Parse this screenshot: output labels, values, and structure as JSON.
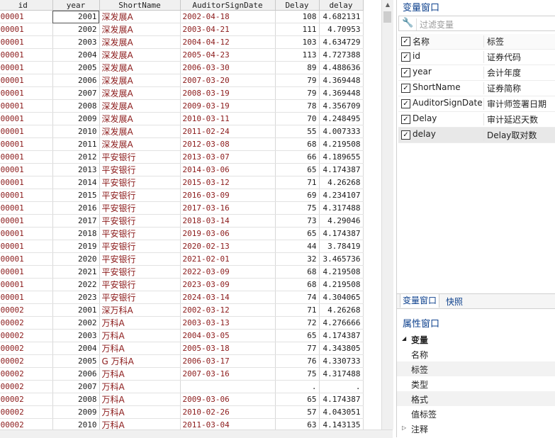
{
  "grid": {
    "columns": [
      "id",
      "year",
      "ShortName",
      "AuditorSignDate",
      "Delay",
      "delay"
    ],
    "rows": [
      [
        "000001",
        "2001",
        "深发展A",
        "2002-04-18",
        "108",
        "4.682131"
      ],
      [
        "000001",
        "2002",
        "深发展A",
        "2003-04-21",
        "111",
        "4.70953"
      ],
      [
        "000001",
        "2003",
        "深发展A",
        "2004-04-12",
        "103",
        "4.634729"
      ],
      [
        "000001",
        "2004",
        "深发展A",
        "2005-04-23",
        "113",
        "4.727388"
      ],
      [
        "000001",
        "2005",
        "深发展A",
        "2006-03-30",
        "89",
        "4.488636"
      ],
      [
        "000001",
        "2006",
        "深发展A",
        "2007-03-20",
        "79",
        "4.369448"
      ],
      [
        "000001",
        "2007",
        "深发展A",
        "2008-03-19",
        "79",
        "4.369448"
      ],
      [
        "000001",
        "2008",
        "深发展A",
        "2009-03-19",
        "78",
        "4.356709"
      ],
      [
        "000001",
        "2009",
        "深发展A",
        "2010-03-11",
        "70",
        "4.248495"
      ],
      [
        "000001",
        "2010",
        "深发展A",
        "2011-02-24",
        "55",
        "4.007333"
      ],
      [
        "000001",
        "2011",
        "深发展A",
        "2012-03-08",
        "68",
        "4.219508"
      ],
      [
        "000001",
        "2012",
        "平安银行",
        "2013-03-07",
        "66",
        "4.189655"
      ],
      [
        "000001",
        "2013",
        "平安银行",
        "2014-03-06",
        "65",
        "4.174387"
      ],
      [
        "000001",
        "2014",
        "平安银行",
        "2015-03-12",
        "71",
        "4.26268"
      ],
      [
        "000001",
        "2015",
        "平安银行",
        "2016-03-09",
        "69",
        "4.234107"
      ],
      [
        "000001",
        "2016",
        "平安银行",
        "2017-03-16",
        "75",
        "4.317488"
      ],
      [
        "000001",
        "2017",
        "平安银行",
        "2018-03-14",
        "73",
        "4.29046"
      ],
      [
        "000001",
        "2018",
        "平安银行",
        "2019-03-06",
        "65",
        "4.174387"
      ],
      [
        "000001",
        "2019",
        "平安银行",
        "2020-02-13",
        "44",
        "3.78419"
      ],
      [
        "000001",
        "2020",
        "平安银行",
        "2021-02-01",
        "32",
        "3.465736"
      ],
      [
        "000001",
        "2021",
        "平安银行",
        "2022-03-09",
        "68",
        "4.219508"
      ],
      [
        "000001",
        "2022",
        "平安银行",
        "2023-03-09",
        "68",
        "4.219508"
      ],
      [
        "000001",
        "2023",
        "平安银行",
        "2024-03-14",
        "74",
        "4.304065"
      ],
      [
        "000002",
        "2001",
        "深万科A",
        "2002-03-12",
        "71",
        "4.26268"
      ],
      [
        "000002",
        "2002",
        "万科A",
        "2003-03-13",
        "72",
        "4.276666"
      ],
      [
        "000002",
        "2003",
        "万科A",
        "2004-03-05",
        "65",
        "4.174387"
      ],
      [
        "000002",
        "2004",
        "万科A",
        "2005-03-18",
        "77",
        "4.343805"
      ],
      [
        "000002",
        "2005",
        "G 万科A",
        "2006-03-17",
        "76",
        "4.330733"
      ],
      [
        "000002",
        "2006",
        "万科A",
        "2007-03-16",
        "75",
        "4.317488"
      ],
      [
        "000002",
        "2007",
        "万科A",
        "",
        ".",
        "."
      ],
      [
        "000002",
        "2008",
        "万科A",
        "2009-03-06",
        "65",
        "4.174387"
      ],
      [
        "000002",
        "2009",
        "万科A",
        "2010-02-26",
        "57",
        "4.043051"
      ],
      [
        "000002",
        "2010",
        "万科A",
        "2011-03-04",
        "63",
        "4.143135"
      ]
    ]
  },
  "variables_panel": {
    "title": "变量窗口",
    "filter_placeholder": "过滤变量",
    "header_name": "名称",
    "header_label": "标签",
    "variables": [
      {
        "name": "id",
        "label": "证券代码"
      },
      {
        "name": "year",
        "label": "会计年度"
      },
      {
        "name": "ShortName",
        "label": "证券简称"
      },
      {
        "name": "AuditorSignDate",
        "label": "审计师签署日期"
      },
      {
        "name": "Delay",
        "label": "审计延迟天数"
      },
      {
        "name": "delay",
        "label": "Delay取对数"
      }
    ],
    "tab_variables": "变量窗口",
    "tab_snapshot": "快照"
  },
  "properties_panel": {
    "title": "属性窗口",
    "group": "变量",
    "items": [
      "名称",
      "标签",
      "类型",
      "格式",
      "值标签"
    ],
    "next_group": "注释"
  }
}
